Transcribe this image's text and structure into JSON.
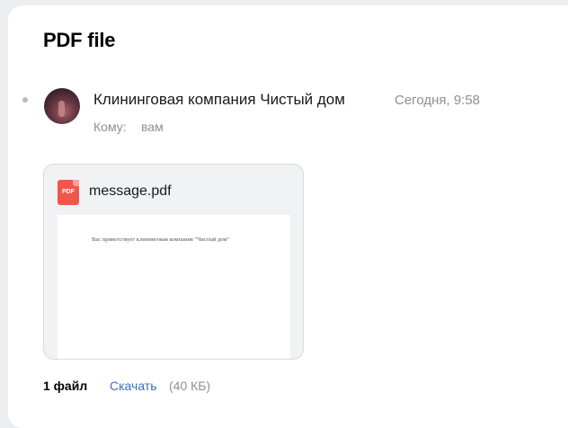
{
  "email": {
    "subject": "PDF file",
    "sender_name": "Клининговая компания Чистый дом",
    "time": "Сегодня, 9:58",
    "to_label": "Кому:",
    "to_value": "вам"
  },
  "attachment": {
    "icon_label": "PDF",
    "file_name": "message.pdf",
    "preview_text": "Вас приветствует клининговая компания \"Чистый дом\""
  },
  "footer": {
    "file_count": "1 файл",
    "download_label": "Скачать",
    "size": "(40 КБ)"
  },
  "colors": {
    "page_bg": "#eceef1",
    "panel_bg": "#ffffff",
    "link": "#3d6fb8",
    "muted_text": "#8d8f98",
    "pdf_red": "#f0574a"
  }
}
